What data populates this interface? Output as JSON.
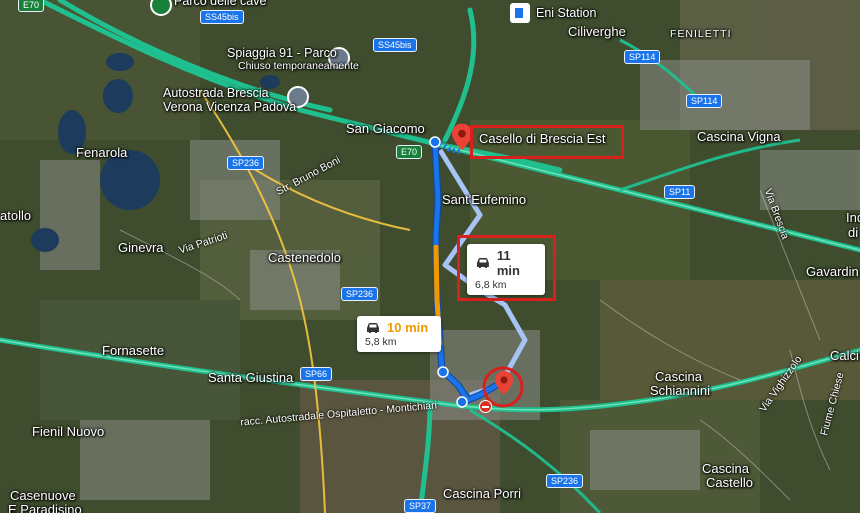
{
  "map": {
    "places": [
      {
        "name": "Fenarola"
      },
      {
        "name": "Ginevra"
      },
      {
        "name": "Castenedolo"
      },
      {
        "name": "Fornasette"
      },
      {
        "name": "Santa Giustina"
      },
      {
        "name": "Fienil Nuovo"
      },
      {
        "name": "Casenuove"
      },
      {
        "name": "E Paradisino"
      },
      {
        "name": "San Giacomo"
      },
      {
        "name": "Sant'Eufemino"
      },
      {
        "name": "Ciliverghe"
      },
      {
        "name": "FENILETTI"
      },
      {
        "name": "Cascina Vigna"
      },
      {
        "name": "Cascina"
      },
      {
        "name": "Schiannini"
      },
      {
        "name": "Cascina"
      },
      {
        "name": "Castello"
      },
      {
        "name": "Cascina Porri"
      },
      {
        "name": "Gavardin"
      },
      {
        "name": "Calci"
      },
      {
        "name": "atollo"
      },
      {
        "name": "Ind"
      },
      {
        "name": "di"
      },
      {
        "name": "Parco delle cave"
      },
      {
        "name": "Eni Station"
      },
      {
        "name": "Spiaggia 91 - Parco"
      },
      {
        "name": "Chiuso temporaneamente"
      },
      {
        "name": "Autostrada Brescia"
      },
      {
        "name": "Verona Vicenza Padova"
      }
    ],
    "road_names": [
      "Str. Bruno Boni",
      "Via Patrioti",
      "racc. Autostradale Ospitaletto - Montichiari",
      "Via Brescia",
      "Via Vighizzolo",
      "Fiume Chiese"
    ],
    "shields": [
      "E70",
      "SS45bis",
      "SS45bis",
      "SP236",
      "SP236",
      "SP236",
      "SP114",
      "SP114",
      "SP11",
      "E70",
      "SP66",
      "SP37"
    ],
    "destination_label": "Casello di Brescia Est",
    "routes": [
      {
        "time": "11 min",
        "distance": "6,8 km",
        "selected": false
      },
      {
        "time": "10 min",
        "distance": "5,8 km",
        "selected": true
      }
    ],
    "colors": {
      "highway": "#1fbf8f",
      "route_primary": "#1a73e8",
      "route_alt": "#a8c3f5",
      "traffic_orange": "#f29900",
      "highlight_red": "#d8201c",
      "pin_red": "#ea4335"
    }
  }
}
